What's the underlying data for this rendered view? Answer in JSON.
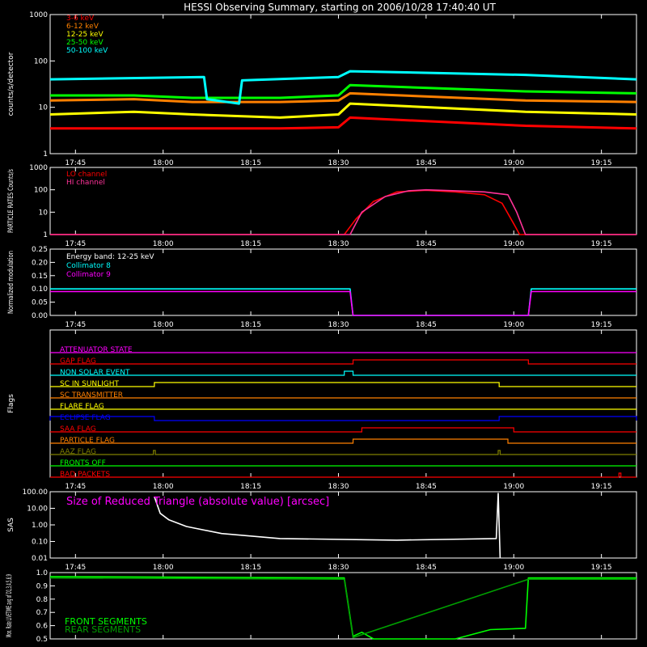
{
  "title": "HESSI Observing Summary, starting on 2006/10/28 17:40:40 UT",
  "time_axis": {
    "start": "17:40:40",
    "end": "19:21:00",
    "tick_labels": [
      "17:45",
      "18:00",
      "18:15",
      "18:30",
      "18:45",
      "19:00",
      "19:15"
    ]
  },
  "colors": {
    "3-6": "#ff0000",
    "6-12": "#ff8000",
    "12-25": "#ffff00",
    "25-50": "#00ff00",
    "50-100": "#00ffff",
    "lo": "#ff0000",
    "hi": "#ff3399",
    "magenta": "#ff00ff",
    "axes": "#ffffff"
  },
  "chart_data": [
    {
      "id": "counts",
      "type": "line",
      "ylabel": "counts/s/detector",
      "y_scale": "log",
      "ylim": [
        1,
        1000
      ],
      "y_ticks": [
        "1",
        "10",
        "100",
        "1000"
      ],
      "series": [
        {
          "name": "3-6 keV",
          "color": "#ff0000",
          "points": [
            [
              "17:40:40",
              3.5
            ],
            [
              "17:55:00",
              3.5
            ],
            [
              "18:05:00",
              3.5
            ],
            [
              "18:20:00",
              3.5
            ],
            [
              "18:30:00",
              3.7
            ],
            [
              "18:32:00",
              6
            ],
            [
              "19:02:00",
              4
            ],
            [
              "19:21:00",
              3.5
            ]
          ]
        },
        {
          "name": "6-12 keV",
          "color": "#ff8000",
          "points": [
            [
              "17:40:40",
              14
            ],
            [
              "17:55:00",
              15
            ],
            [
              "18:05:00",
              13
            ],
            [
              "18:20:00",
              13
            ],
            [
              "18:30:00",
              14
            ],
            [
              "18:32:00",
              20
            ],
            [
              "19:02:00",
              14
            ],
            [
              "19:21:00",
              13
            ]
          ]
        },
        {
          "name": "12-25 keV",
          "color": "#ffff00",
          "points": [
            [
              "17:40:40",
              7
            ],
            [
              "17:55:00",
              8
            ],
            [
              "18:05:00",
              7
            ],
            [
              "18:20:00",
              6
            ],
            [
              "18:30:00",
              7
            ],
            [
              "18:32:00",
              12
            ],
            [
              "19:02:00",
              8
            ],
            [
              "19:21:00",
              7
            ]
          ]
        },
        {
          "name": "25-50 keV",
          "color": "#00ff00",
          "points": [
            [
              "17:40:40",
              18
            ],
            [
              "17:55:00",
              18
            ],
            [
              "18:05:00",
              16
            ],
            [
              "18:20:00",
              16
            ],
            [
              "18:30:00",
              18
            ],
            [
              "18:32:00",
              30
            ],
            [
              "19:02:00",
              22
            ],
            [
              "19:21:00",
              20
            ]
          ]
        },
        {
          "name": "50-100 keV",
          "color": "#00ffff",
          "points": [
            [
              "17:40:40",
              40
            ],
            [
              "18:07:00",
              45
            ],
            [
              "18:07:30",
              15
            ],
            [
              "18:13:00",
              12
            ],
            [
              "18:13:30",
              38
            ],
            [
              "18:30:00",
              45
            ],
            [
              "18:32:00",
              60
            ],
            [
              "19:02:00",
              50
            ],
            [
              "19:21:00",
              40
            ]
          ]
        }
      ],
      "gaps": [
        [
          "18:32:30",
          "19:02:30"
        ]
      ]
    },
    {
      "id": "particle",
      "type": "line",
      "ylabel": "PARTICLE RATES Counts/s",
      "y_scale": "log",
      "ylim": [
        1,
        1000
      ],
      "y_ticks": [
        "1",
        "10",
        "100",
        "1000"
      ],
      "series": [
        {
          "name": "LO channel",
          "color": "#ff0000",
          "points": [
            [
              "17:40:40",
              1
            ],
            [
              "18:31:00",
              1
            ],
            [
              "18:33:00",
              5
            ],
            [
              "18:36:00",
              30
            ],
            [
              "18:40:00",
              80
            ],
            [
              "18:45:00",
              95
            ],
            [
              "18:50:00",
              80
            ],
            [
              "18:55:00",
              60
            ],
            [
              "18:58:00",
              25
            ],
            [
              "19:00:00",
              3
            ],
            [
              "19:01:00",
              1
            ],
            [
              "19:21:00",
              1
            ]
          ]
        },
        {
          "name": "HI channel",
          "color": "#ff3399",
          "points": [
            [
              "17:40:40",
              1
            ],
            [
              "18:32:00",
              1
            ],
            [
              "18:34:00",
              10
            ],
            [
              "18:38:00",
              50
            ],
            [
              "18:42:00",
              90
            ],
            [
              "18:45:00",
              100
            ],
            [
              "18:50:00",
              90
            ],
            [
              "18:55:00",
              80
            ],
            [
              "18:59:00",
              60
            ],
            [
              "19:00:30",
              10
            ],
            [
              "19:02:00",
              1
            ],
            [
              "19:21:00",
              1
            ]
          ]
        }
      ]
    },
    {
      "id": "modulation",
      "type": "line",
      "ylabel": "Normalized modulation",
      "ylim": [
        0,
        0.25
      ],
      "y_ticks": [
        "0.00",
        "0.05",
        "0.10",
        "0.15",
        "0.20",
        "0.25"
      ],
      "annotation": "Energy band: 12-25 keV",
      "series": [
        {
          "name": "Collimator 8",
          "color": "#00ffff",
          "points": [
            [
              "17:40:40",
              0.1
            ],
            [
              "18:32:00",
              0.1
            ],
            [
              "18:32:30",
              0
            ],
            [
              "19:02:30",
              0
            ],
            [
              "19:03:00",
              0.1
            ],
            [
              "19:21:00",
              0.1
            ]
          ]
        },
        {
          "name": "Collimator 9",
          "color": "#ff00ff",
          "points": [
            [
              "17:40:40",
              0.09
            ],
            [
              "18:32:00",
              0.09
            ],
            [
              "18:32:30",
              0
            ],
            [
              "19:02:30",
              0
            ],
            [
              "19:03:00",
              0.09
            ],
            [
              "19:21:00",
              0.09
            ]
          ]
        }
      ]
    },
    {
      "id": "flags",
      "type": "line",
      "ylabel": "Flags",
      "rows": [
        {
          "name": "ATTENUATOR STATE",
          "color": "#ff00ff",
          "on": []
        },
        {
          "name": "GAP FLAG",
          "color": "#ff0000",
          "on": [
            [
              "18:32:30",
              "19:02:30"
            ]
          ]
        },
        {
          "name": "NON SOLAR EVENT",
          "color": "#00ffff",
          "on": [
            [
              "18:31:00",
              "18:32:30"
            ]
          ]
        },
        {
          "name": "SC IN SUNLIGHT",
          "color": "#ffff00",
          "on": [
            [
              "17:58:30",
              "18:57:30"
            ]
          ]
        },
        {
          "name": "SC TRANSMITTER",
          "color": "#ff8000",
          "on": []
        },
        {
          "name": "FLARE FLAG",
          "color": "#ffff00",
          "on": []
        },
        {
          "name": "ECLIPSE FLAG",
          "color": "#0000ff",
          "on": [
            [
              "17:40:40",
              "17:58:30"
            ],
            [
              "18:57:30",
              "19:21:00"
            ]
          ]
        },
        {
          "name": "SAA FLAG",
          "color": "#ff0000",
          "on": [
            [
              "18:34:00",
              "19:00:00"
            ]
          ]
        },
        {
          "name": "PARTICLE FLAG",
          "color": "#ff8000",
          "on": [
            [
              "18:32:30",
              "18:59:00"
            ]
          ]
        },
        {
          "name": "AAZ FLAG",
          "color": "#808000",
          "on": [
            [
              "17:58:20",
              "17:58:40"
            ],
            [
              "18:57:20",
              "18:57:40"
            ]
          ]
        },
        {
          "name": "FRONTS OFF",
          "color": "#00ff00",
          "on": []
        },
        {
          "name": "BAD PACKETS",
          "color": "#ff0000",
          "on": [
            [
              "19:18:00",
              "19:18:20"
            ]
          ]
        }
      ]
    },
    {
      "id": "sas",
      "type": "line",
      "ylabel": "SAS",
      "y_scale": "log",
      "ylim": [
        0.01,
        100
      ],
      "y_ticks": [
        "0.01",
        "0.10",
        "1.00",
        "10.00",
        "100.00"
      ],
      "annotation": "Size of Reduced Triangle (absolute value) [arcsec]",
      "series": [
        {
          "name": "",
          "color": "#ffffff",
          "points": [
            [
              "17:58:30",
              50
            ],
            [
              "17:59:30",
              5
            ],
            [
              "18:01:00",
              2
            ],
            [
              "18:04:00",
              0.8
            ],
            [
              "18:10:00",
              0.3
            ],
            [
              "18:20:00",
              0.15
            ],
            [
              "18:40:00",
              0.12
            ],
            [
              "18:57:00",
              0.15
            ],
            [
              "18:57:20",
              80
            ],
            [
              "18:57:40",
              0.01
            ]
          ]
        }
      ]
    },
    {
      "id": "livetime",
      "type": "line",
      "ylabel": "Mon. Rate LIVETIME avg of D1,3,4,5,6,9",
      "ylim": [
        0.5,
        1.0
      ],
      "y_ticks": [
        "0.5",
        "0.6",
        "0.7",
        "0.8",
        "0.9",
        "1.0"
      ],
      "series": [
        {
          "name": "FRONT SEGMENTS",
          "color": "#00ff00",
          "points": [
            [
              "17:40:40",
              0.97
            ],
            [
              "18:31:00",
              0.96
            ],
            [
              "18:32:30",
              0.52
            ],
            [
              "18:34:00",
              0.55
            ],
            [
              "18:36:00",
              0.5
            ],
            [
              "18:50:00",
              0.5
            ],
            [
              "18:56:00",
              0.57
            ],
            [
              "19:02:00",
              0.58
            ],
            [
              "19:02:30",
              0.96
            ],
            [
              "19:21:00",
              0.96
            ]
          ]
        },
        {
          "name": "REAR SEGMENTS",
          "color": "#00a000",
          "points": [
            [
              "17:40:40",
              0.96
            ],
            [
              "18:31:00",
              0.95
            ],
            [
              "18:32:30",
              0.51
            ],
            [
              "19:02:30",
              0.95
            ],
            [
              "19:21:00",
              0.95
            ]
          ]
        }
      ]
    }
  ]
}
